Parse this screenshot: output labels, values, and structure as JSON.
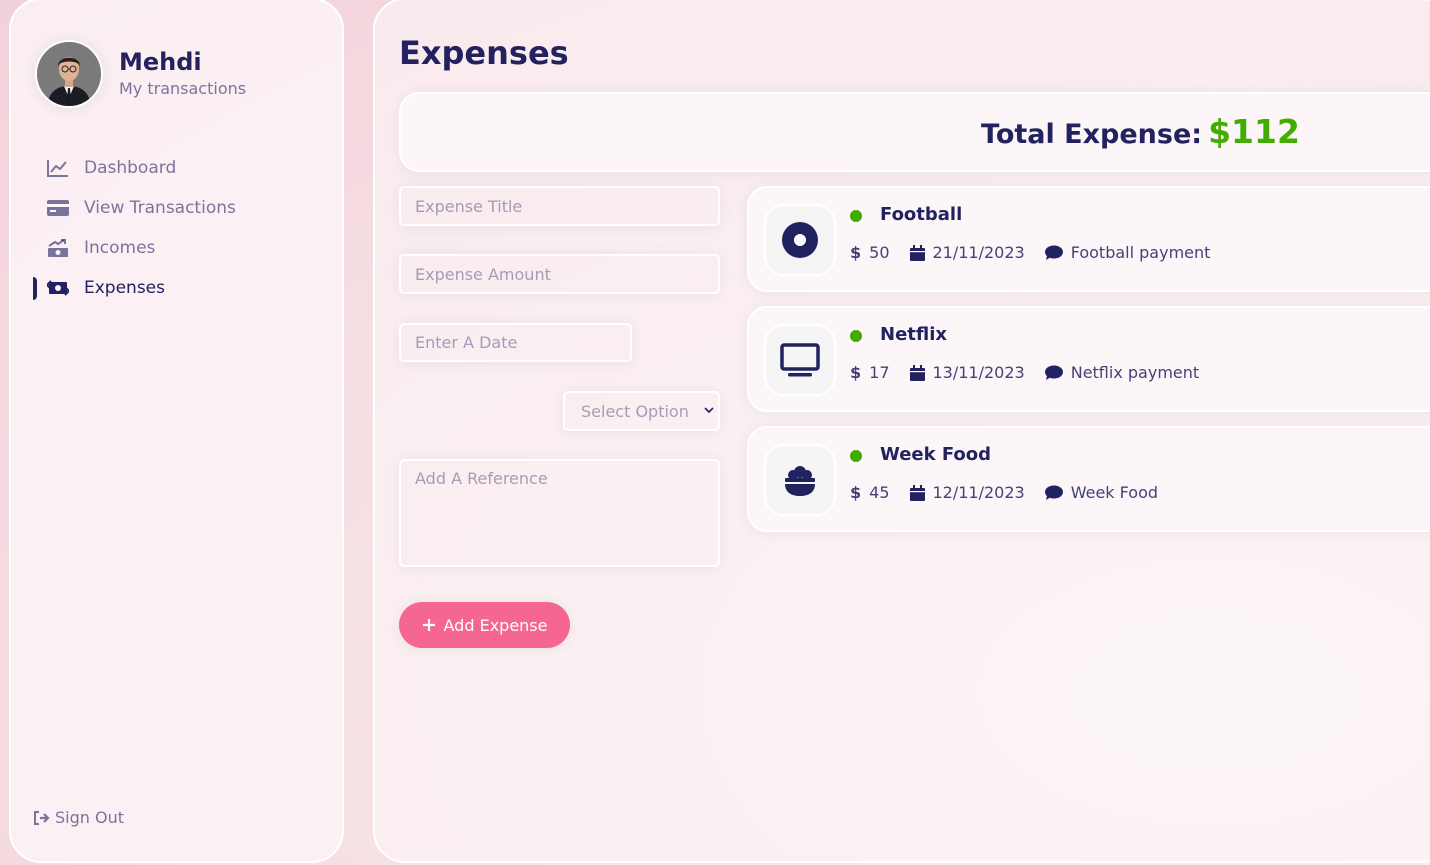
{
  "user": {
    "name": "Mehdi",
    "subtitle": "My transactions"
  },
  "nav": {
    "items": [
      {
        "label": "Dashboard",
        "icon": "chart-line-icon"
      },
      {
        "label": "View Transactions",
        "icon": "credit-card-icon"
      },
      {
        "label": "Incomes",
        "icon": "money-bill-trend-up-icon"
      },
      {
        "label": "Expenses",
        "icon": "money-bill-transfer-icon",
        "active": true
      }
    ],
    "signout": "Sign Out"
  },
  "page": {
    "title": "Expenses"
  },
  "total": {
    "label": "Total Expense:",
    "value": "$112"
  },
  "form": {
    "title_placeholder": "Expense Title",
    "amount_placeholder": "Expense Amount",
    "date_placeholder": "Enter A Date",
    "select_placeholder": "Select Option",
    "reference_placeholder": "Add A Reference",
    "submit_label": "Add Expense"
  },
  "expenses": [
    {
      "title": "Football",
      "amount": "50",
      "date": "21/11/2023",
      "description": "Football payment",
      "icon": "circle-dot-icon"
    },
    {
      "title": "Netflix",
      "amount": "17",
      "date": "13/11/2023",
      "description": "Netflix payment",
      "icon": "tv-icon"
    },
    {
      "title": "Week Food",
      "amount": "45",
      "date": "12/11/2023",
      "description": "Week Food",
      "icon": "bowl-food-icon"
    }
  ],
  "currency_symbol": "$",
  "colors": {
    "primary": "#222260",
    "accent": "#F56692",
    "green": "#42AD00"
  }
}
